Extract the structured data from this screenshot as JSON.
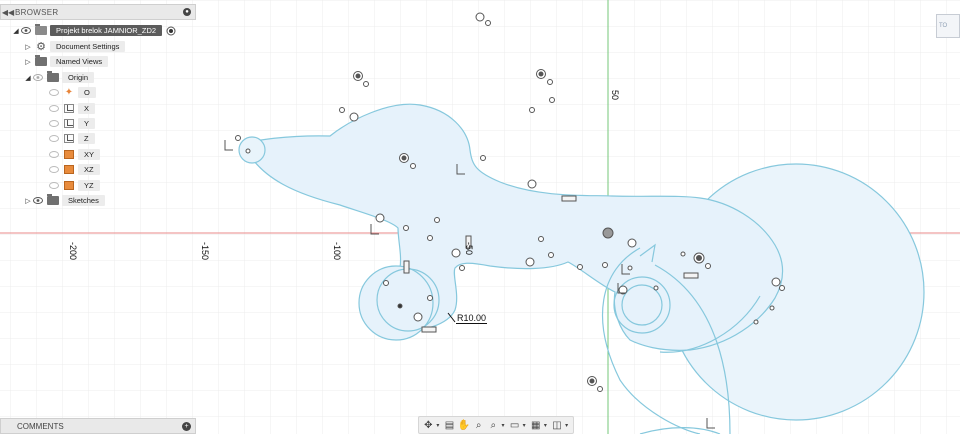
{
  "browser": {
    "header_label": "BROWSER",
    "project_name": "Projekt brelok JAMNIOR_ZD2",
    "items": [
      {
        "label": "Document Settings"
      },
      {
        "label": "Named Views"
      },
      {
        "label": "Origin"
      },
      {
        "label": "O"
      },
      {
        "label": "X"
      },
      {
        "label": "Y"
      },
      {
        "label": "Z"
      },
      {
        "label": "XY"
      },
      {
        "label": "XZ"
      },
      {
        "label": "YZ"
      },
      {
        "label": "Sketches"
      }
    ]
  },
  "comments": {
    "label": "COMMENTS"
  },
  "canvas": {
    "ruler_x": [
      "-200",
      "-150",
      "-100",
      "-50"
    ],
    "ruler_y": [
      "50"
    ],
    "dimension": "R10.00",
    "viewcube_label": "TO",
    "colors": {
      "sketch_fill": "#e8f3fb",
      "sketch_stroke": "#7fc6dc",
      "x_axis": "#e26b6b",
      "y_axis": "#65c46b",
      "grid": "#ebebeb"
    }
  },
  "toolbar": {
    "icons": [
      "orbit-icon",
      "look-at-icon",
      "pan-icon",
      "zoom-icon",
      "fit-icon",
      "display-settings-icon",
      "grid-icon",
      "viewports-icon"
    ]
  }
}
